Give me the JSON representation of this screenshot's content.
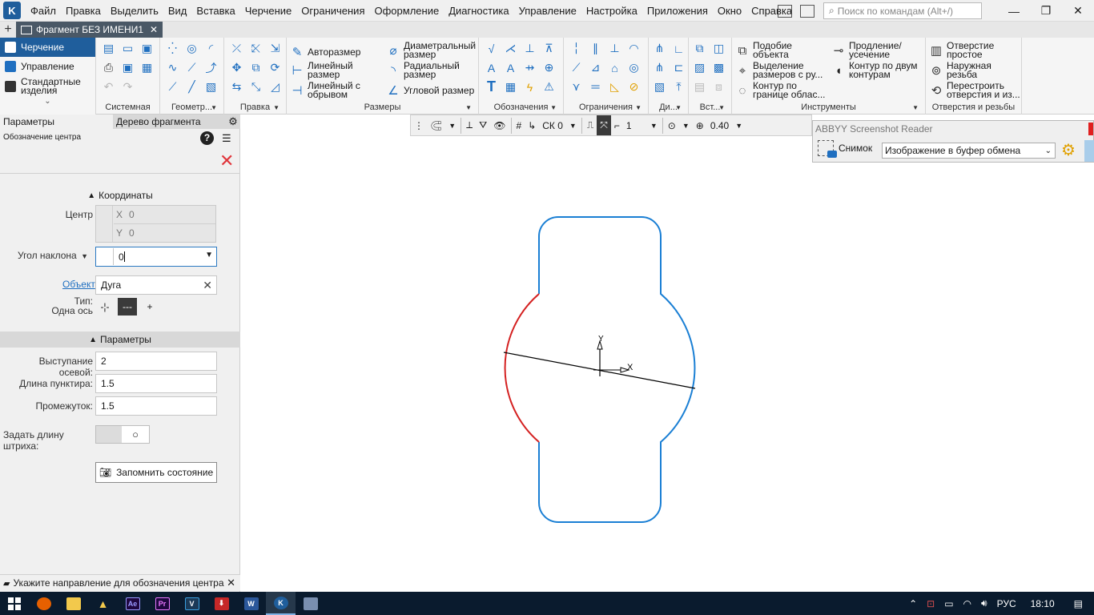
{
  "menubar": {
    "items": [
      "Файл",
      "Правка",
      "Выделить",
      "Вид",
      "Вставка",
      "Черчение",
      "Ограничения",
      "Оформление",
      "Диагностика",
      "Управление",
      "Настройка",
      "Приложения",
      "Окно",
      "Справка"
    ],
    "search_placeholder": "Поиск по командам (Alt+/)"
  },
  "tabbar": {
    "doc_tab": "Фрагмент БЕЗ ИМЕНИ1"
  },
  "ribbon": {
    "left": {
      "active": "Черчение",
      "manage": "Управление",
      "std1": "Стандартные",
      "std2": "изделия"
    },
    "groups": {
      "system": "Системная",
      "geometry": "Геометр...",
      "edit": "Правка",
      "dims": "Размеры",
      "notation": "Обозначения",
      "constraints": "Ограничения",
      "diag": "Ди...",
      "insert": "Вст...",
      "tools": "Инструменты",
      "holes": "Отверстия и резьбы"
    },
    "dims": {
      "auto": "Авторазмер",
      "linear1": "Линейный",
      "linear2": "размер",
      "linear_break1": "Линейный с",
      "linear_break2": "обрывом",
      "diam1": "Диаметральный",
      "diam2": "размер",
      "radial1": "Радиальный",
      "radial2": "размер",
      "angle": "Угловой размер"
    },
    "tools": {
      "similar1": "Подобие",
      "similar2": "объекта",
      "select_dims1": "Выделение",
      "select_dims2": "размеров с ру...",
      "contour_area1": "Контур по",
      "contour_area2": "границе облас...",
      "extend1": "Продление/",
      "extend2": "усечение",
      "contour_two1": "Контур по двум",
      "contour_two2": "контурам"
    },
    "holes": {
      "simple1": "Отверстие",
      "simple2": "простое",
      "thread1": "Наружная",
      "thread2": "резьба",
      "rebuild1": "Перестроить",
      "rebuild2": "отверстия и из..."
    }
  },
  "left_panel": {
    "tab_params": "Параметры",
    "tab_tree": "Дерево фрагмента",
    "operation_title": "Обозначение центра",
    "coords": {
      "title": "Координаты",
      "center_label": "Центр",
      "x_label": "X",
      "x_value": "0",
      "y_label": "Y",
      "y_value": "0",
      "angle_label": "Угол наклона",
      "angle_value": "0",
      "object_label": "Объект",
      "object_value": "Дуга",
      "type_label": "Тип:",
      "type_value": "Одна ось"
    },
    "params": {
      "title": "Параметры",
      "axis_label": "Выступание осевой:",
      "axis_value": "2",
      "dash_label": "Длина пунктира:",
      "dash_value": "1.5",
      "gap_label": "Промежуток:",
      "gap_value": "1.5",
      "stroke_label": "Задать длину штриха:",
      "save_state": "Запомнить состояние"
    }
  },
  "hint": {
    "text": "Укажите направление для обозначения центра"
  },
  "draw_toolbar": {
    "cs": "СК 0",
    "layer": "1",
    "zoom": "0.40"
  },
  "abbyy": {
    "title": "ABBYY Screenshot Reader",
    "snapshot_label": "Снимок",
    "mode": "Изображение в буфер обмена"
  },
  "drawing": {
    "x_axis_label": "X",
    "y_axis_label": "Y",
    "contour_color": "#1a7fd4",
    "selected_arc_color": "#d42020"
  },
  "taskbar": {
    "lang": "РУС",
    "time": "18:10",
    "apps": [
      "Ae",
      "Pr",
      "V"
    ]
  }
}
